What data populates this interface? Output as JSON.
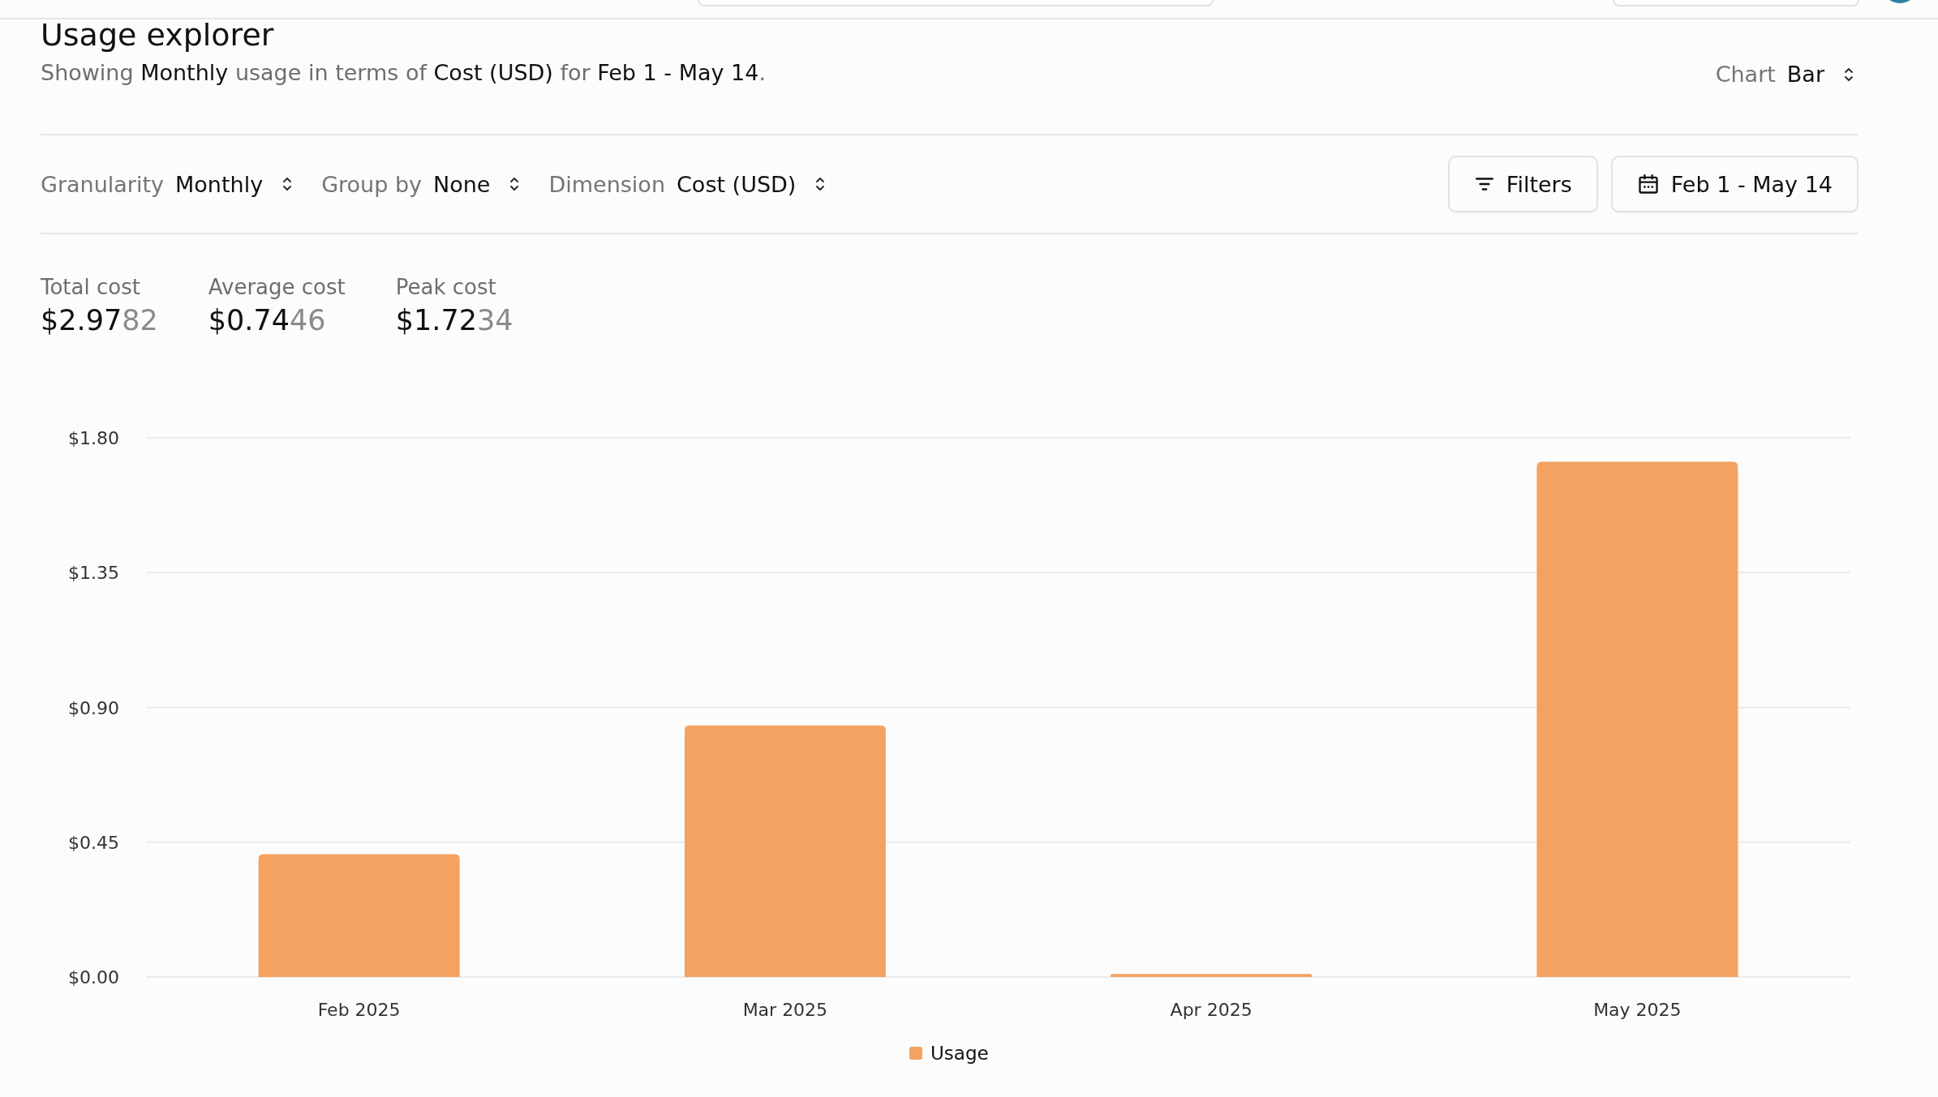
{
  "page": {
    "title": "Usage explorer",
    "summary": "Showing **Monthly** usage in terms of **Cost (USD)** for **Feb 1 - May 14**.",
    "chart_type": {
      "label": "Chart",
      "value": "Bar"
    }
  },
  "controls": [
    {
      "label": "Granularity",
      "value": "Monthly"
    },
    {
      "label": "Group by",
      "value": "None"
    },
    {
      "label": "Dimension",
      "value": "Cost (USD)"
    }
  ],
  "buttons": [
    {
      "kind": "filter",
      "label": "Filters"
    },
    {
      "kind": "date",
      "label": "Feb 1 - May 14"
    }
  ],
  "metrics": [
    {
      "label": "Total cost",
      "value": "$2.97",
      "value_tail": "82"
    },
    {
      "label": "Average cost",
      "value": "$0.74",
      "value_tail": "46"
    },
    {
      "label": "Peak cost",
      "value": "$1.72",
      "value_tail": "34"
    }
  ],
  "chart": {
    "chart_data": {
      "type": "bar",
      "categories": [
        "Feb 2025",
        "Mar 2025",
        "Apr 2025",
        "May 2025"
      ],
      "series": [
        {
          "name": "Usage",
          "color": "#f4a261",
          "values": [
            0.41,
            0.84,
            0.01,
            1.72
          ]
        }
      ],
      "grid": true,
      "ylim": [
        0,
        1.8
      ],
      "yticks": [
        {
          "value": 0,
          "label": "$0.00"
        },
        {
          "value": 0.45,
          "label": "$0.45"
        },
        {
          "value": 0.9,
          "label": "$0.90"
        },
        {
          "value": 1.35,
          "label": "$1.35"
        },
        {
          "value": 1.8,
          "label": "$1.80"
        }
      ]
    }
  }
}
